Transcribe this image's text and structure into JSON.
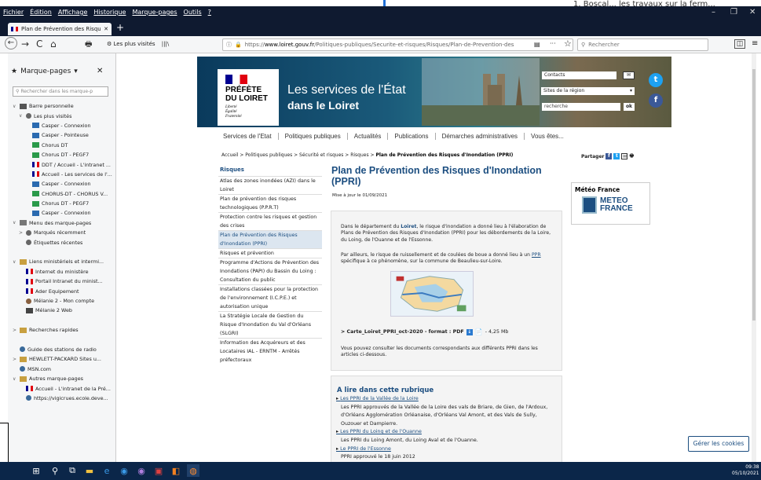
{
  "background_fragment": "1. Boscal... les travaux sur la ferm...",
  "menu": [
    "Fichier",
    "Édition",
    "Affichage",
    "Historique",
    "Marque-pages",
    "Outils",
    "?"
  ],
  "window_controls": [
    "–",
    "❐",
    "✕"
  ],
  "tab": {
    "title": "Plan de Prévention des Risques",
    "close": "✕",
    "new_tab": "+"
  },
  "nav": {
    "back": "←",
    "forward": "→",
    "reload": "C",
    "home": "⌂",
    "print": "🖶",
    "frequent": "Les plus visités",
    "library": "|||\\",
    "url_domain": "www.loiret.gouv.fr",
    "url_path": "/Politiques-publiques/Securite-et-risques/Risques/Plan-de-Prevention-des",
    "url_scheme": "https://",
    "menu_dots": "···",
    "star": "☆",
    "search_placeholder": "Rechercher"
  },
  "sidebar": {
    "title": "Marque-pages",
    "close": "✕",
    "search_placeholder": "Rechercher dans les marque-p",
    "items": [
      {
        "label": "Barre personnelle",
        "lvl": 0,
        "tw": "∨",
        "icon": "toolbar"
      },
      {
        "label": "Les plus visités",
        "lvl": 1,
        "tw": "∨",
        "icon": "gear"
      },
      {
        "label": "Casper - Connexion",
        "lvl": 2,
        "tw": "",
        "icon": "casper"
      },
      {
        "label": "Casper - Pointeuse",
        "lvl": 2,
        "tw": "",
        "icon": "casper"
      },
      {
        "label": "Chorus DT",
        "lvl": 2,
        "tw": "",
        "icon": "chorus"
      },
      {
        "label": "Chorus DT - PEGF7",
        "lvl": 2,
        "tw": "",
        "icon": "chorus"
      },
      {
        "label": "DDT / Accueil - L'intranet ...",
        "lvl": 2,
        "tw": "",
        "icon": "flag"
      },
      {
        "label": "Accueil - Les services de l'...",
        "lvl": 2,
        "tw": "",
        "icon": "flag"
      },
      {
        "label": "Casper - Connexion",
        "lvl": 2,
        "tw": "",
        "icon": "casper"
      },
      {
        "label": "CHORUS-DT - CHORUS V...",
        "lvl": 2,
        "tw": "",
        "icon": "chorus"
      },
      {
        "label": "Chorus DT - PEGF7",
        "lvl": 2,
        "tw": "",
        "icon": "chorus"
      },
      {
        "label": "Casper - Connexion",
        "lvl": 2,
        "tw": "",
        "icon": "casper"
      },
      {
        "label": "Menu des marque-pages",
        "lvl": 0,
        "tw": "∨",
        "icon": "menu"
      },
      {
        "label": "Marqués récemment",
        "lvl": 1,
        "tw": ">",
        "icon": "gear"
      },
      {
        "label": "Étiquettes récentes",
        "lvl": 1,
        "tw": "",
        "icon": "gear"
      },
      {
        "label": "",
        "lvl": 0,
        "tw": "",
        "icon": ""
      },
      {
        "label": "Liens ministériels et intermi...",
        "lvl": 0,
        "tw": "∨",
        "icon": "folder"
      },
      {
        "label": "Internet du ministère",
        "lvl": 1,
        "tw": "",
        "icon": "flag"
      },
      {
        "label": "Portail Intranet du minist...",
        "lvl": 1,
        "tw": "",
        "icon": "flag"
      },
      {
        "label": "Ader Equipement",
        "lvl": 1,
        "tw": "",
        "icon": "flag"
      },
      {
        "label": "Mélanie 2 - Mon compte",
        "lvl": 1,
        "tw": "",
        "icon": "user"
      },
      {
        "label": "Mélanie 2 Web",
        "lvl": 1,
        "tw": "",
        "icon": "pen"
      },
      {
        "label": "",
        "lvl": 0,
        "tw": "",
        "icon": ""
      },
      {
        "label": "Recherches rapides",
        "lvl": 0,
        "tw": ">",
        "icon": "folder"
      },
      {
        "label": "",
        "lvl": 0,
        "tw": "",
        "icon": ""
      },
      {
        "label": "Guide des stations de radio",
        "lvl": 0,
        "tw": "",
        "icon": "globe"
      },
      {
        "label": "HEWLETT-PACKARD Sites u...",
        "lvl": 0,
        "tw": ">",
        "icon": "folder"
      },
      {
        "label": "MSN.com",
        "lvl": 0,
        "tw": "",
        "icon": "globe"
      },
      {
        "label": "Autres marque-pages",
        "lvl": 0,
        "tw": "∨",
        "icon": "folder"
      },
      {
        "label": "Accueil - L'intranet de la Pré...",
        "lvl": 1,
        "tw": "",
        "icon": "flag"
      },
      {
        "label": "https://vigicrues.ecole.deve...",
        "lvl": 1,
        "tw": "",
        "icon": "globe"
      }
    ]
  },
  "header": {
    "logo_line1": "PRÉFÈTE",
    "logo_line2": "DU LOIRET",
    "motto": [
      "Liberté",
      "Égalité",
      "Fraternité"
    ],
    "title1": "Les services de l'État",
    "title2": "dans le Loiret",
    "contacts": "Contacts",
    "sites": "Sites de la région",
    "search_placeholder": "recherche",
    "ok": "ok",
    "mail": "✉",
    "twitter": "t",
    "facebook": "f"
  },
  "mainnav": [
    "Services de l'Etat",
    "Politiques publiques",
    "Actualités",
    "Publications",
    "Démarches administratives",
    "Vous êtes..."
  ],
  "breadcrumb": {
    "path": "Accueil > Politiques publiques > Sécurité et risques > Risques > ",
    "current": "Plan de Prévention des Risques d'Inondation (PPRI)"
  },
  "share": {
    "label": "Partager",
    "fb": "f",
    "tw": "t",
    "mail": "✉",
    "print": "🖶"
  },
  "leftnav": {
    "heading": "Risques",
    "items": [
      {
        "label": "Atlas des zones inondées (AZI) dans le Loiret",
        "active": false
      },
      {
        "label": "Plan de prévention des risques technologiques (P.P.R.T)",
        "active": false
      },
      {
        "label": "Protection contre les risques et gestion des crises",
        "active": false
      },
      {
        "label": "Plan de Prévention des Risques d'Inondation (PPRI)",
        "active": true
      },
      {
        "label": "Risques et prévention",
        "active": false
      },
      {
        "label": "Programme d'Actions de Prévention des Inondations (PAPI) du Bassin du Loing : Consultation du public",
        "active": false
      },
      {
        "label": "Installations classées pour la protection de l'environnement (I.C.P.E.) et autorisation unique",
        "active": false
      },
      {
        "label": "La Stratégie Locale de Gestion du Risque d'Inondation du Val d'Orléans (SLGRI)",
        "active": false
      },
      {
        "label": "Information des Acquéreurs et des Locataires IAL - ERNTM - Arrêtés préfectoraux",
        "active": false
      }
    ]
  },
  "article": {
    "title": "Plan de Prévention des Risques d'Inondation (PPRI)",
    "updated": "Mise à jour le 01/09/2021",
    "p1_a": "Dans le département du ",
    "p1_b": "Loiret",
    "p1_c": ", le risque d'inondation a donné lieu à l'élaboration de Plans de Prévention des Risques d'Inondation (PPRI) pour les débordements de la Loire, du Loing, de l'Ouanne et de l'Essonne.",
    "p2_a": "Par ailleurs, le risque de ruissellement et de coulées de boue a donné lieu à un ",
    "p2_link": "PPR",
    "p2_b": " spécifique à ce phénomène, sur la commune de Beaulieu-sur-Loire.",
    "file_label": "> Carte_Loiret_PPRI_oct-2020 - format : PDF",
    "file_size": "- 4,25 Mb",
    "p3": "Vous pouvez consulter les documents correspondants aux différents PPRI dans les articles ci-dessous."
  },
  "meteo": {
    "title": "Météo France",
    "logo1": "METEO",
    "logo2": "FRANCE"
  },
  "alire": {
    "heading": "A lire dans cette rubrique",
    "items": [
      {
        "link": "Les PPRI de la Vallée de la Loire",
        "text": "Les PPRI approuvés de la Vallée de la Loire des vals de Briare, de Gien, de l'Ardoux, d'Orléans Agglomération Orléanaise, d'Orléans Val Amont, et des Vals de Sully, Ouzouer et Dampierre."
      },
      {
        "link": "Les PPRI du Loing et de l'Ouanne",
        "text": "Les PPRI du Loing Amont, du Loing Aval et de l'Ouanne."
      },
      {
        "link": "Le PPRI de l'Essonne",
        "text": "PPRI approuvé le 18 juin 2012"
      }
    ]
  },
  "cookies": "Gérer les cookies",
  "taskbar": {
    "time": "09:38",
    "date": "05/10/2021"
  }
}
